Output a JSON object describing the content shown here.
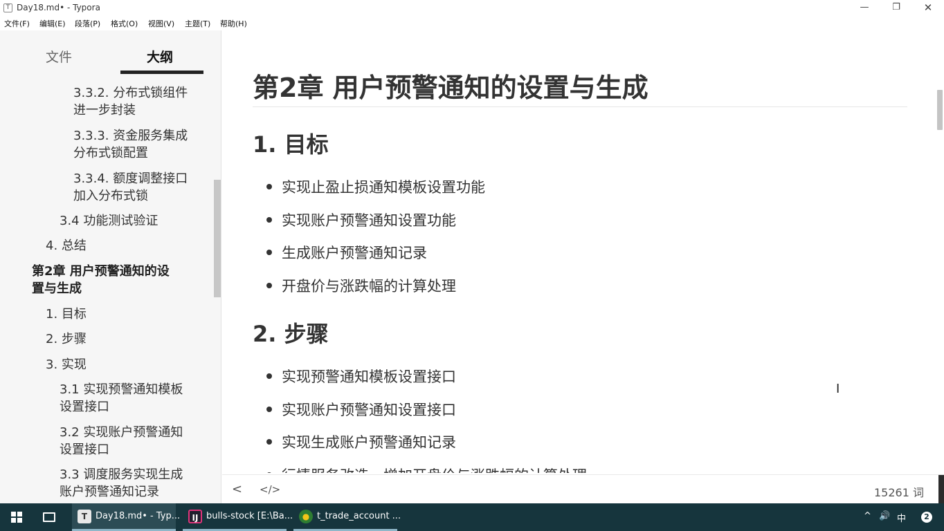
{
  "window": {
    "title": "Day18.md• - Typora",
    "icon_letter": "T",
    "controls": [
      "—",
      "❐",
      "✕"
    ]
  },
  "menu": [
    "文件(F)",
    "编辑(E)",
    "段落(P)",
    "格式(O)",
    "视图(V)",
    "主题(T)",
    "帮助(H)"
  ],
  "sidebar": {
    "tab_files": "文件",
    "tab_outline": "大纲",
    "outline": [
      {
        "line1": "3.3.2. 分布式锁组件",
        "line2": "进一步封装"
      },
      {
        "line1": "3.3.3. 资金服务集成",
        "line2": "分布式锁配置"
      },
      {
        "line1": "3.3.4. 额度调整接口",
        "line2": "加入分布式锁"
      },
      {
        "line1": "3.4 功能测试验证"
      },
      {
        "line1": "4. 总结"
      },
      {
        "line1": "第2章 用户预警通知的设",
        "line2": "置与生成"
      },
      {
        "line1": "1. 目标"
      },
      {
        "line1": "2. 步骤"
      },
      {
        "line1": "3. 实现"
      },
      {
        "line1": "3.1 实现预警通知模板",
        "line2": "设置接口"
      },
      {
        "line1": "3.2 实现账户预警通知",
        "line2": "设置接口"
      },
      {
        "line1": "3.3 调度服务实现生成",
        "line2": "账户预警通知记录"
      }
    ]
  },
  "document": {
    "h1": "第2章 用户预警通知的设置与生成",
    "sections": [
      {
        "heading": "1. 目标",
        "items": [
          "实现止盈止损通知模板设置功能",
          "实现账户预警通知设置功能",
          "生成账户预警通知记录",
          "开盘价与涨跌幅的计算处理"
        ]
      },
      {
        "heading": "2. 步骤",
        "items": [
          "实现预警通知模板设置接口",
          "实现账户预警通知设置接口",
          "实现生成账户预警通知记录",
          "行情服务改造，增加开盘价与涨跌幅的计算处理"
        ]
      }
    ]
  },
  "bottombar": {
    "back_glyph": "<",
    "source_glyph": "</>",
    "word_count": "15261 词"
  },
  "taskbar": {
    "tasks": [
      {
        "icon": "T",
        "label": "Day18.md• - Typ..."
      },
      {
        "icon": "IJ",
        "label": "bulls-stock [E:\\Ba..."
      },
      {
        "icon": "●",
        "label": "t_trade_account ..."
      }
    ],
    "tray": {
      "chevron": "^",
      "volume": "🔊",
      "ime": "中",
      "notifications": "2"
    }
  }
}
